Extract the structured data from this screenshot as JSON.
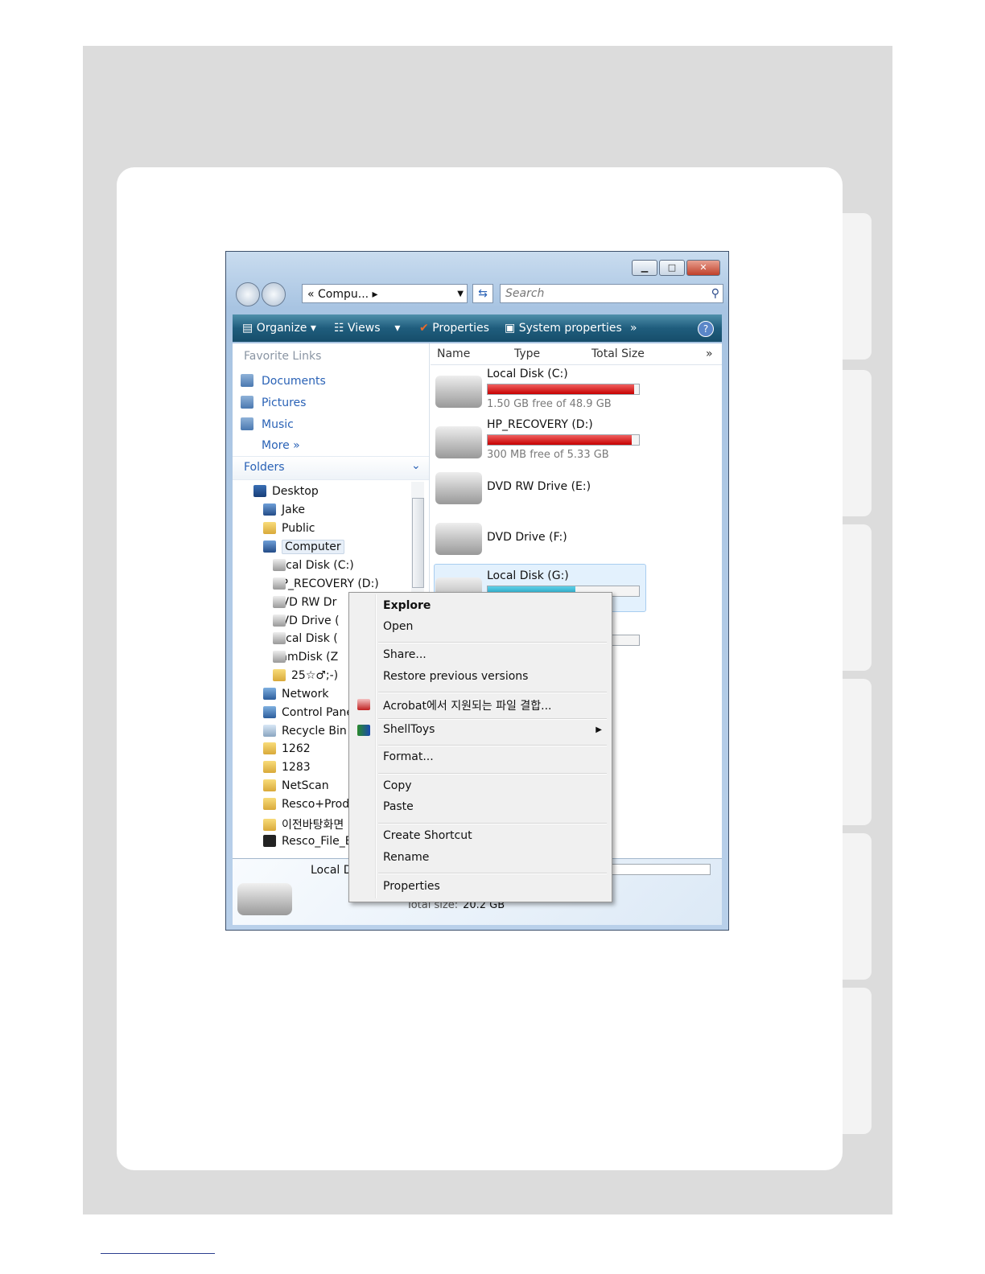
{
  "window": {
    "address": "« Compu... ▸",
    "search_placeholder": "Search",
    "toolbar": {
      "organize": "Organize",
      "views": "Views",
      "properties": "Properties",
      "system_properties": "System properties",
      "more": "»"
    },
    "favorite_links": {
      "header": "Favorite Links",
      "items": [
        "Documents",
        "Pictures",
        "Music",
        "More  »"
      ]
    },
    "folders_header": "Folders",
    "tree": [
      "Desktop",
      "Jake",
      "Public",
      "Computer",
      "Local Disk (C:)",
      "HP_RECOVERY (D:)",
      "DVD RW Dr",
      "DVD Drive (",
      "Local Disk (",
      "RamDisk (Z",
      "25☆♂;-)",
      "Network",
      "Control Pane",
      "Recycle Bin",
      "1262",
      "1283",
      "NetScan",
      "Resco+Produ",
      "이전바탕화면",
      "Resco_File_Ex"
    ],
    "columns": [
      "Name",
      "Type",
      "Total Size",
      "»"
    ],
    "drives": [
      {
        "name": "Local Disk (C:)",
        "free": "1.50 GB free of 48.9 GB",
        "used_fraction": 0.97,
        "bar": "red"
      },
      {
        "name": "HP_RECOVERY (D:)",
        "free": "300 MB free of 5.33 GB",
        "used_fraction": 0.95,
        "bar": "red"
      },
      {
        "name": "DVD RW Drive (E:)"
      },
      {
        "name": "DVD Drive (F:)"
      },
      {
        "name": "Local Disk (G:)",
        "used_fraction": 0.58,
        "bar": "blue"
      }
    ],
    "details": {
      "name": "Local D",
      "total_label": "Total size:",
      "total_value": "20.2 GB"
    }
  },
  "context_menu": {
    "explore": "Explore",
    "open": "Open",
    "share": "Share...",
    "restore": "Restore previous versions",
    "acrobat": "Acrobat에서 지원되는 파일 결합...",
    "shelltoys": "ShellToys",
    "format": "Format...",
    "copy": "Copy",
    "paste": "Paste",
    "create_shortcut": "Create Shortcut",
    "rename": "Rename",
    "properties": "Properties"
  },
  "colors": {
    "toolbar": "#1f5d7d",
    "link": "#2a62b6",
    "bar_red": "#c60000",
    "bar_blue": "#1a9ab8"
  }
}
